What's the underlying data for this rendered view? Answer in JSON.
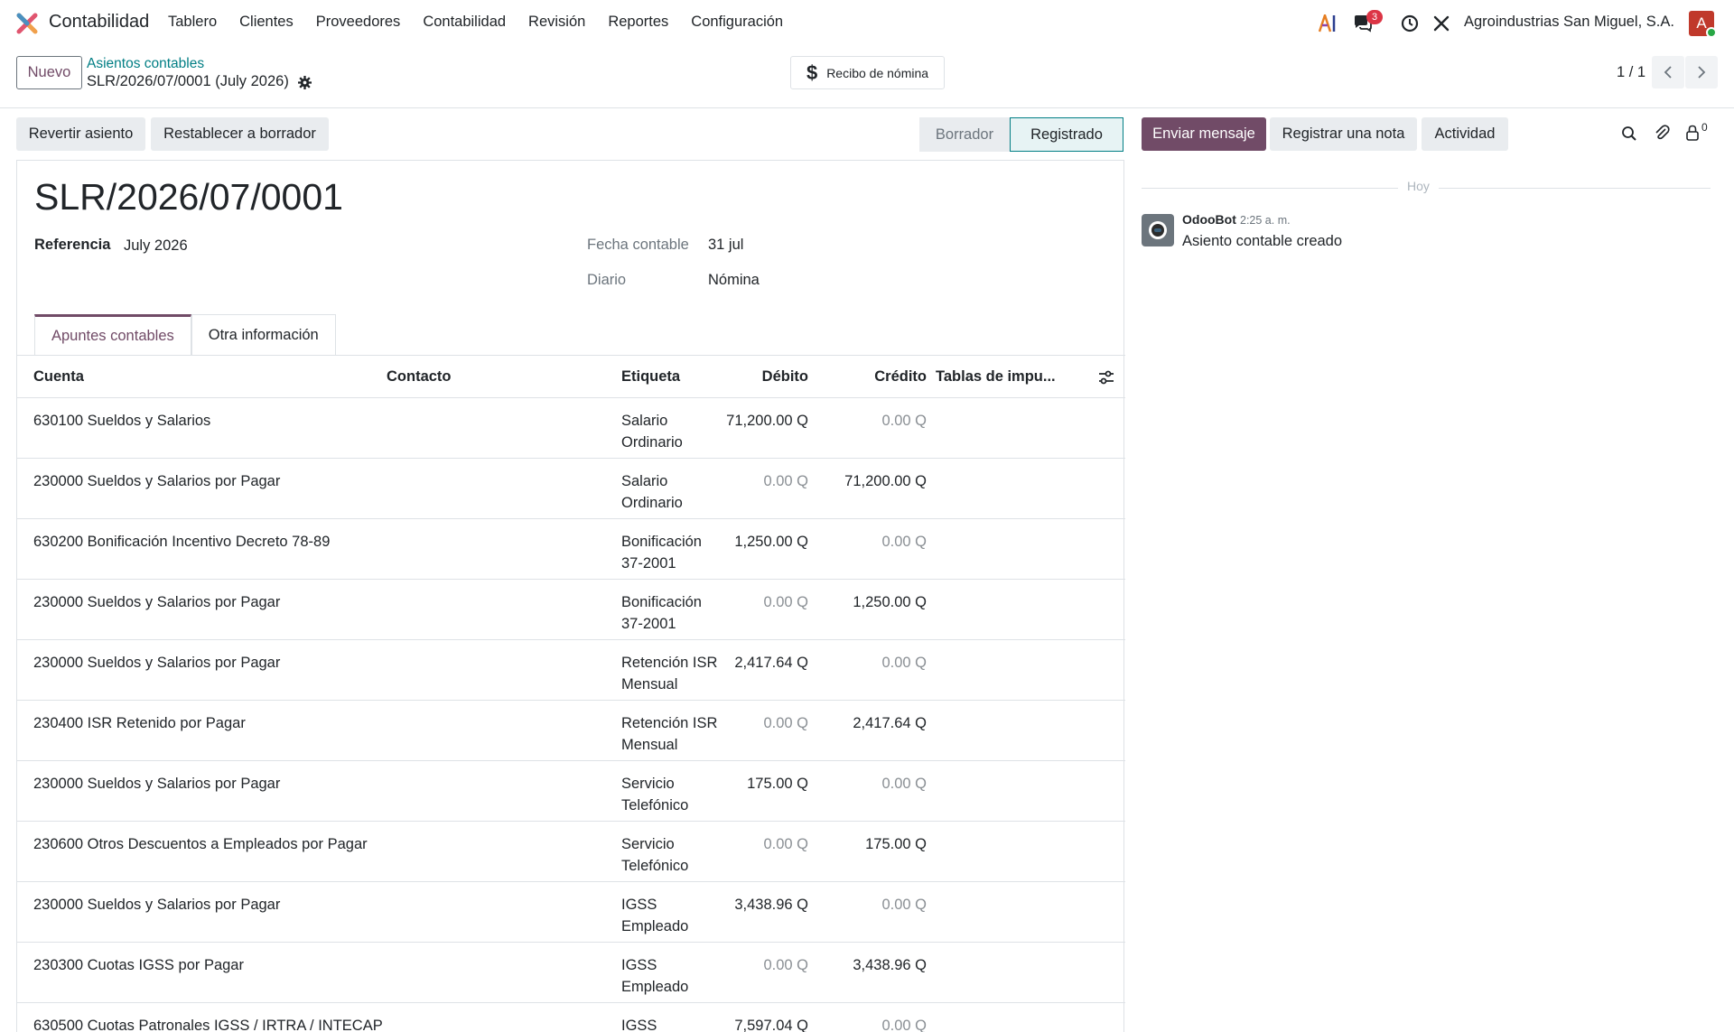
{
  "app": {
    "name": "Contabilidad",
    "menu": [
      "Tablero",
      "Clientes",
      "Proveedores",
      "Contabilidad",
      "Revisión",
      "Reportes",
      "Configuración"
    ],
    "company": "Agroindustrias San Miguel, S.A.",
    "avatar_initial": "A",
    "messages_count": "3"
  },
  "control": {
    "new_label": "Nuevo",
    "breadcrumb_parent": "Asientos contables",
    "breadcrumb_current": "SLR/2026/07/0001 (July 2026)",
    "smart_button": "Recibo de nómina",
    "pager": "1 / 1"
  },
  "actions": {
    "reverse": "Revertir asiento",
    "reset": "Restablecer a borrador",
    "status_draft": "Borrador",
    "status_posted": "Registrado"
  },
  "form": {
    "title": "SLR/2026/07/0001",
    "ref_label": "Referencia",
    "ref_value": "July 2026",
    "date_label": "Fecha contable",
    "date_value": "31 jul",
    "journal_label": "Diario",
    "journal_value": "Nómina",
    "tabs": [
      "Apuntes contables",
      "Otra información"
    ]
  },
  "lines": {
    "headers": {
      "account": "Cuenta",
      "partner": "Contacto",
      "label": "Etiqueta",
      "debit": "Débito",
      "credit": "Crédito",
      "tax": "Tablas de impu..."
    },
    "rows": [
      {
        "account": "630100 Sueldos y Salarios",
        "label": "Salario Ordinario",
        "debit": "71,200.00 Q",
        "credit": "0.00 Q"
      },
      {
        "account": "230000 Sueldos y Salarios por Pagar",
        "label": "Salario Ordinario",
        "debit": "0.00 Q",
        "credit": "71,200.00 Q"
      },
      {
        "account": "630200 Bonificación Incentivo Decreto 78-89",
        "label": "Bonificación 37-2001",
        "debit": "1,250.00 Q",
        "credit": "0.00 Q"
      },
      {
        "account": "230000 Sueldos y Salarios por Pagar",
        "label": "Bonificación 37-2001",
        "debit": "0.00 Q",
        "credit": "1,250.00 Q"
      },
      {
        "account": "230000 Sueldos y Salarios por Pagar",
        "label": "Retención ISR Mensual",
        "debit": "2,417.64 Q",
        "credit": "0.00 Q"
      },
      {
        "account": "230400 ISR Retenido por Pagar",
        "label": "Retención ISR Mensual",
        "debit": "0.00 Q",
        "credit": "2,417.64 Q"
      },
      {
        "account": "230000 Sueldos y Salarios por Pagar",
        "label": "Servicio Telefónico",
        "debit": "175.00 Q",
        "credit": "0.00 Q"
      },
      {
        "account": "230600 Otros Descuentos a Empleados por Pagar",
        "label": "Servicio Telefónico",
        "debit": "0.00 Q",
        "credit": "175.00 Q"
      },
      {
        "account": "230000 Sueldos y Salarios por Pagar",
        "label": "IGSS Empleado",
        "debit": "3,438.96 Q",
        "credit": "0.00 Q"
      },
      {
        "account": "230300 Cuotas IGSS por Pagar",
        "label": "IGSS Empleado",
        "debit": "0.00 Q",
        "credit": "3,438.96 Q"
      },
      {
        "account": "630500 Cuotas Patronales IGSS / IRTRA / INTECAP",
        "label": "IGSS",
        "debit": "7,597.04 Q",
        "credit": "0.00 Q"
      }
    ]
  },
  "chatter": {
    "send_message": "Enviar mensaje",
    "log_note": "Registrar una nota",
    "activity": "Actividad",
    "followers_count": "0",
    "today": "Hoy",
    "author": "OdooBot",
    "time": "2:25 a. m.",
    "message": "Asiento contable creado"
  },
  "colors": {
    "primary": "#714b67",
    "link": "#017e84"
  }
}
